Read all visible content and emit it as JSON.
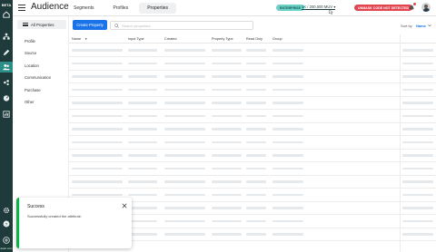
{
  "rail": {
    "badge": "BETA",
    "items": [
      "home-icon",
      "connections-icon",
      "pencil-icon",
      "audience-icon",
      "users-icon",
      "gauge-icon",
      "reports-icon",
      "settings-gear-icon",
      "help-icon",
      "add-icon"
    ],
    "footer_text": "dash.com"
  },
  "header": {
    "title": "Audience",
    "tabs": [
      "Segments",
      "Profiles",
      "Properties"
    ],
    "active_tab": "Properties",
    "plan_badge": "ENTERPRISE",
    "mtu_text": "1K / 200,000 MUV ▾",
    "unmask_badge": "UNMASK CODE NOT DETECTED"
  },
  "subnav": {
    "all_properties_label": "All Properties",
    "categories": [
      "Profile",
      "Source",
      "Location",
      "Communication",
      "Purchase",
      "Other"
    ]
  },
  "toolbar": {
    "create_label": "Create Property",
    "search_placeholder": "Search properties",
    "sort_label": "Sort by",
    "sort_value": "Name"
  },
  "table": {
    "columns": [
      "Name",
      "Input Type",
      "Created",
      "Property Type",
      "Read Only",
      "Group"
    ],
    "row_count": 15
  },
  "toast": {
    "title": "Success",
    "message": "Successfully created the attribute.",
    "status_color": "#1fa84f"
  },
  "colors": {
    "accent": "#1a73e8",
    "rail": "#1f3a3a",
    "plan": "#69d1c6",
    "danger": "#e2454f"
  }
}
